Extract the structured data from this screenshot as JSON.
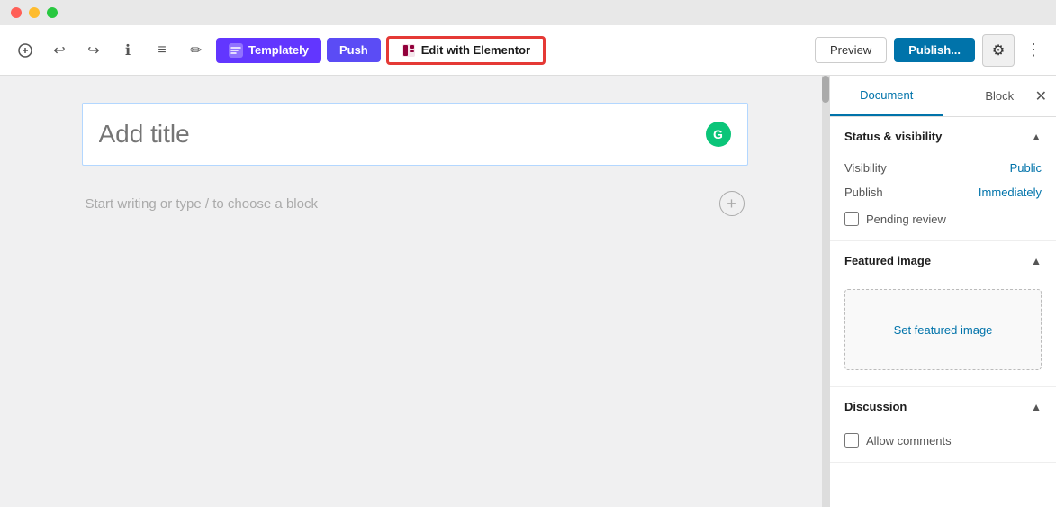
{
  "titleBar": {
    "lights": [
      "red",
      "yellow",
      "green"
    ]
  },
  "toolbar": {
    "undo_icon": "↩",
    "redo_icon": "↪",
    "info_icon": "ℹ",
    "list_icon": "≡",
    "pen_icon": "✏",
    "templately_label": "Templately",
    "push_label": "Push",
    "elementor_label": "Edit with Elementor",
    "preview_label": "Preview",
    "publish_label": "Publish...",
    "settings_icon": "⚙",
    "more_icon": "⋮"
  },
  "editor": {
    "title_placeholder": "Add title",
    "content_placeholder": "Start writing or type / to choose a block",
    "grammarly_letter": "G"
  },
  "sidebar": {
    "tab_document": "Document",
    "tab_block": "Block",
    "close_icon": "✕",
    "sections": {
      "status_visibility": {
        "title": "Status & visibility",
        "visibility_label": "Visibility",
        "visibility_value": "Public",
        "publish_label": "Publish",
        "publish_value": "Immediately",
        "pending_review_label": "Pending review"
      },
      "featured_image": {
        "title": "Featured image",
        "set_label": "Set featured image"
      },
      "discussion": {
        "title": "Discussion",
        "allow_comments_label": "Allow comments"
      }
    }
  }
}
